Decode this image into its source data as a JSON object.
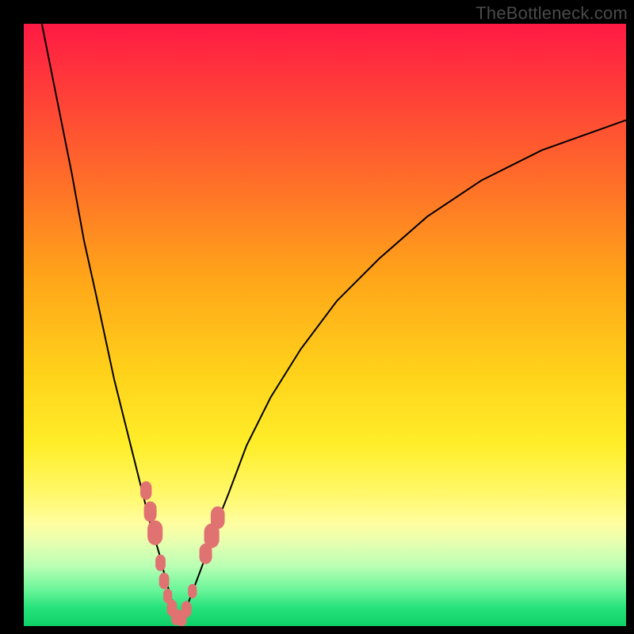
{
  "watermark": "TheBottleneck.com",
  "colors": {
    "background": "#000000",
    "gradient_top": "#ff1a44",
    "gradient_bottom": "#0fd168",
    "curve": "#000000",
    "markers": "#e17272"
  },
  "chart_data": {
    "type": "line",
    "title": "",
    "xlabel": "",
    "ylabel": "",
    "xlim": [
      0,
      100
    ],
    "ylim": [
      0,
      100
    ],
    "annotations": [],
    "series": [
      {
        "name": "bottleneck-curve-left",
        "x": [
          3,
          5,
          8,
          10,
          12,
          15,
          17,
          18.5,
          20,
          21,
          22.5,
          23.5,
          24.5,
          25,
          25.7
        ],
        "values": [
          100,
          90,
          75,
          64,
          55,
          41,
          33,
          27,
          21,
          17,
          12,
          8,
          4.5,
          2.5,
          0.5
        ]
      },
      {
        "name": "bottleneck-curve-right",
        "x": [
          25.7,
          27,
          28.5,
          30,
          32,
          34,
          37,
          41,
          46,
          52,
          59,
          67,
          76,
          86,
          100
        ],
        "values": [
          0.5,
          3,
          7,
          11,
          17,
          22,
          30,
          38,
          46,
          54,
          61,
          68,
          74,
          79,
          84
        ]
      }
    ],
    "markers": [
      {
        "x": 20.3,
        "y": 22.5,
        "size": 9
      },
      {
        "x": 21.0,
        "y": 19.0,
        "size": 10
      },
      {
        "x": 21.8,
        "y": 15.5,
        "size": 12
      },
      {
        "x": 22.7,
        "y": 10.5,
        "size": 8
      },
      {
        "x": 23.3,
        "y": 7.5,
        "size": 8
      },
      {
        "x": 23.9,
        "y": 5.0,
        "size": 7
      },
      {
        "x": 24.6,
        "y": 3.0,
        "size": 8
      },
      {
        "x": 25.3,
        "y": 1.5,
        "size": 8
      },
      {
        "x": 26.2,
        "y": 1.3,
        "size": 8
      },
      {
        "x": 27.0,
        "y": 2.8,
        "size": 8
      },
      {
        "x": 28.0,
        "y": 5.8,
        "size": 7
      },
      {
        "x": 30.2,
        "y": 12.0,
        "size": 10
      },
      {
        "x": 31.2,
        "y": 15.0,
        "size": 12
      },
      {
        "x": 32.2,
        "y": 18.0,
        "size": 11
      }
    ]
  }
}
